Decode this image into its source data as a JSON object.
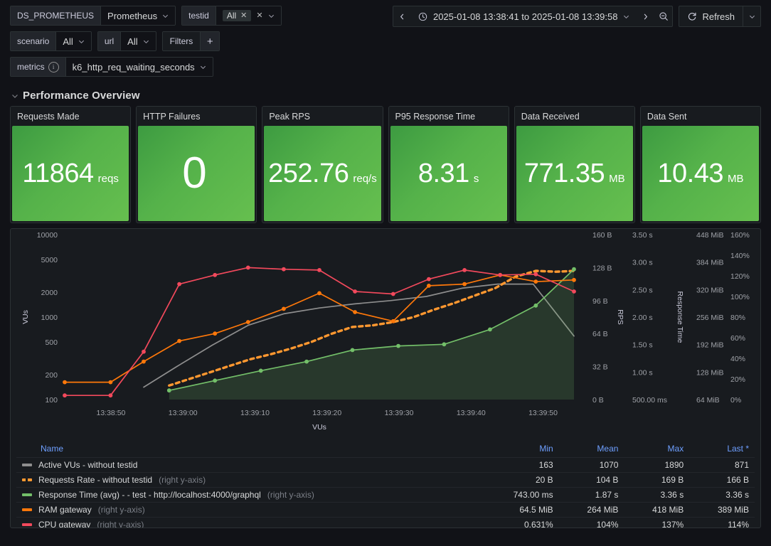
{
  "variables": [
    [
      {
        "name": "datasource",
        "label": "DS_PROMETHEUS",
        "value": "Prometheus",
        "type": "select"
      },
      {
        "name": "testid",
        "label": "testid",
        "value": "All",
        "type": "multi-tag"
      }
    ],
    [
      {
        "name": "scenario",
        "label": "scenario",
        "value": "All",
        "type": "select"
      },
      {
        "name": "url",
        "label": "url",
        "value": "All",
        "type": "select"
      },
      {
        "name": "filters",
        "label": "Filters",
        "value": "+",
        "type": "adhoc"
      }
    ],
    [
      {
        "name": "metrics",
        "label": "metrics",
        "value": "k6_http_req_waiting_seconds",
        "type": "select",
        "has_info": true
      }
    ]
  ],
  "timepicker": {
    "range": "2025-01-08 13:38:41 to 2025-01-08 13:39:58",
    "prev_icon": "chevron-left-icon",
    "next_icon": "chevron-right-icon",
    "clock_icon": "clock-icon",
    "zoom_out_icon": "zoom-out-icon",
    "refresh_label": "Refresh",
    "refresh_icon": "refresh-icon"
  },
  "row": {
    "title": "Performance Overview",
    "collapse_icon": "chevron-down-icon"
  },
  "stats": [
    {
      "title": "Requests Made",
      "value": "11864",
      "unit": "reqs",
      "color": "#55b24a"
    },
    {
      "title": "HTTP Failures",
      "value": "0",
      "unit": "",
      "color": "#55b24a",
      "big": true
    },
    {
      "title": "Peak RPS",
      "value": "252.76",
      "unit": "req/s",
      "color": "#55b24a"
    },
    {
      "title": "P95 Response Time",
      "value": "8.31",
      "unit": "s",
      "color": "#55b24a"
    },
    {
      "title": "Data Received",
      "value": "771.35",
      "unit": "MB",
      "color": "#55b24a"
    },
    {
      "title": "Data Sent",
      "value": "10.43",
      "unit": "MB",
      "color": "#55b24a"
    }
  ],
  "legend": {
    "columns": [
      "Name",
      "Min",
      "Mean",
      "Max",
      "Last *"
    ],
    "rows": [
      {
        "name": "Active VUs - without testid",
        "axis": "",
        "color": "#8e8e8e",
        "style": "solid",
        "min": "163",
        "mean": "1070",
        "max": "1890",
        "last": "871"
      },
      {
        "name": "Requests Rate - without testid",
        "axis": "(right y-axis)",
        "color": "#ff9830",
        "style": "dashed",
        "min": "20 B",
        "mean": "104 B",
        "max": "169 B",
        "last": "166 B"
      },
      {
        "name": "Response Time (avg) - - test - http://localhost:4000/graphql",
        "axis": "(right y-axis)",
        "color": "#73bf69",
        "style": "solid",
        "min": "743.00 ms",
        "mean": "1.87 s",
        "max": "3.36 s",
        "last": "3.36 s"
      },
      {
        "name": "RAM gateway",
        "axis": "(right y-axis)",
        "color": "#ff780a",
        "style": "solid",
        "min": "64.5 MiB",
        "mean": "264 MiB",
        "max": "418 MiB",
        "last": "389 MiB"
      },
      {
        "name": "CPU gateway",
        "axis": "(right y-axis)",
        "color": "#f2495c",
        "style": "solid",
        "min": "0.631%",
        "mean": "104%",
        "max": "137%",
        "last": "114%"
      }
    ]
  },
  "chart_data": {
    "type": "line",
    "title": "",
    "xlabel": "VUs",
    "grid": false,
    "legend_position": "bottom-table",
    "x_ticks": [
      "13:38:50",
      "13:39:00",
      "13:39:10",
      "13:39:20",
      "13:39:30",
      "13:39:40",
      "13:39:50"
    ],
    "axes": [
      {
        "id": "left",
        "label": "VUs",
        "scale": "log",
        "ticks": [
          "100",
          "200",
          "500",
          "1000",
          "2000",
          "5000",
          "10000"
        ]
      },
      {
        "id": "right-bytes",
        "label": "",
        "ticks": [
          "0 B",
          "32 B",
          "64 B",
          "96 B",
          "128 B",
          "160 B"
        ]
      },
      {
        "id": "right-rps",
        "label": "RPS",
        "ticks": [
          "500.00 ms",
          "1.00 s",
          "1.50 s",
          "2.00 s",
          "2.50 s",
          "3.00 s",
          "3.50 s"
        ]
      },
      {
        "id": "right-resptime",
        "label": "Response Time",
        "ticks": [
          "64 MiB",
          "128 MiB",
          "192 MiB",
          "256 MiB",
          "320 MiB",
          "384 MiB",
          "448 MiB"
        ]
      },
      {
        "id": "right-pct",
        "label": "",
        "ticks": [
          "0%",
          "20%",
          "40%",
          "60%",
          "80%",
          "100%",
          "120%",
          "140%",
          "160%"
        ]
      }
    ],
    "series": [
      {
        "name": "Active VUs - without testid",
        "color": "#8e8e8e",
        "style": "solid",
        "points": false,
        "x": [
          0.155,
          0.22,
          0.29,
          0.36,
          0.43,
          0.5,
          0.57,
          0.64,
          0.71,
          0.78,
          0.85,
          0.92,
          1.0
        ],
        "y": [
          0.075,
          0.2,
          0.33,
          0.45,
          0.52,
          0.555,
          0.58,
          0.6,
          0.625,
          0.675,
          0.7,
          0.7,
          0.385
        ]
      },
      {
        "name": "Requests Rate - without testid",
        "color": "#ff9830",
        "style": "dashed",
        "points": true,
        "x": [
          0.205,
          0.245,
          0.285,
          0.325,
          0.365,
          0.405,
          0.445,
          0.485,
          0.525,
          0.565,
          0.605,
          0.645,
          0.685,
          0.725,
          0.765,
          0.805,
          0.845,
          0.885,
          0.925,
          0.965,
          1.0
        ],
        "y": [
          0.085,
          0.125,
          0.165,
          0.205,
          0.245,
          0.275,
          0.31,
          0.35,
          0.4,
          0.44,
          0.45,
          0.47,
          0.5,
          0.545,
          0.585,
          0.63,
          0.675,
          0.745,
          0.78,
          0.775,
          0.78
        ]
      },
      {
        "name": "Response Time (avg) - - test - http://localhost:4000/graphql",
        "color": "#73bf69",
        "style": "area",
        "points": true,
        "x": [
          0.205,
          0.295,
          0.385,
          0.475,
          0.565,
          0.655,
          0.745,
          0.835,
          0.925,
          1.0
        ],
        "y": [
          0.055,
          0.115,
          0.175,
          0.23,
          0.3,
          0.325,
          0.335,
          0.425,
          0.57,
          0.79
        ]
      },
      {
        "name": "RAM gateway",
        "color": "#ff780a",
        "style": "solid",
        "points": true,
        "x": [
          0.0,
          0.09,
          0.155,
          0.225,
          0.295,
          0.36,
          0.43,
          0.5,
          0.57,
          0.645,
          0.715,
          0.785,
          0.855,
          0.925,
          1.0
        ],
        "y": [
          0.105,
          0.105,
          0.23,
          0.355,
          0.4,
          0.47,
          0.55,
          0.645,
          0.53,
          0.475,
          0.69,
          0.7,
          0.755,
          0.715,
          0.725
        ]
      },
      {
        "name": "CPU gateway",
        "color": "#f2495c",
        "style": "solid",
        "points": true,
        "x": [
          0.0,
          0.09,
          0.155,
          0.225,
          0.295,
          0.36,
          0.43,
          0.5,
          0.57,
          0.645,
          0.715,
          0.785,
          0.855,
          0.925,
          1.0
        ],
        "y": [
          0.025,
          0.025,
          0.29,
          0.7,
          0.755,
          0.8,
          0.79,
          0.785,
          0.655,
          0.64,
          0.73,
          0.785,
          0.755,
          0.76,
          0.655
        ]
      }
    ]
  }
}
